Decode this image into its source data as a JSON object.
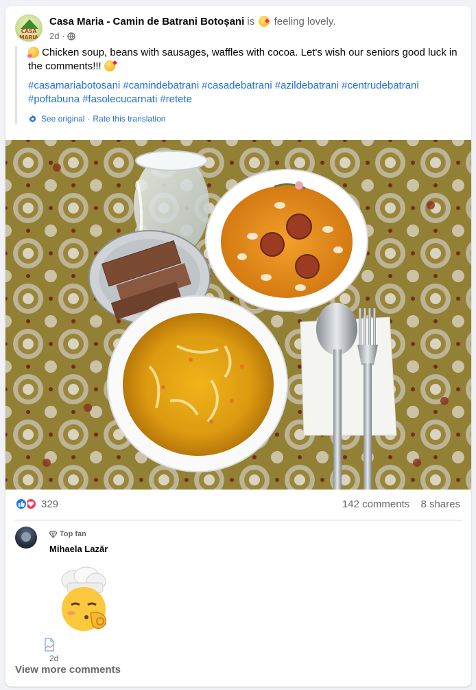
{
  "post": {
    "author": "Casa Maria - Camin de Batrani Botoșani",
    "is_text": "is",
    "feeling": "feeling lovely.",
    "time": "2d",
    "avatar_logo_text": "CASA MARIA",
    "text": "Chicken soup, beans with sausages, waffles with cocoa. Let's wish our seniors good luck in the comments!!!",
    "hashtags": [
      "#casamariabotosani",
      "#camindebatrani",
      "#casadebatrani",
      "#azildebatrani",
      "#centrudebatrani",
      "#poftabuna",
      "#fasolecucarnati",
      "#retete"
    ],
    "translation": {
      "see_original": "See original",
      "separator": "·",
      "rate": "Rate this translation"
    }
  },
  "stats": {
    "reactions_count": "329",
    "comments": "142 comments",
    "shares": "8 shares"
  },
  "comment": {
    "badge": "Top fan",
    "name": "Mihaela Lazăr",
    "time": "2d"
  },
  "view_more_label": "View more comments",
  "colors": {
    "link": "#216fdb",
    "like": "#1877f2",
    "love": "#f33e58",
    "muted": "#65676b",
    "tablecloth": "#a8933f"
  }
}
